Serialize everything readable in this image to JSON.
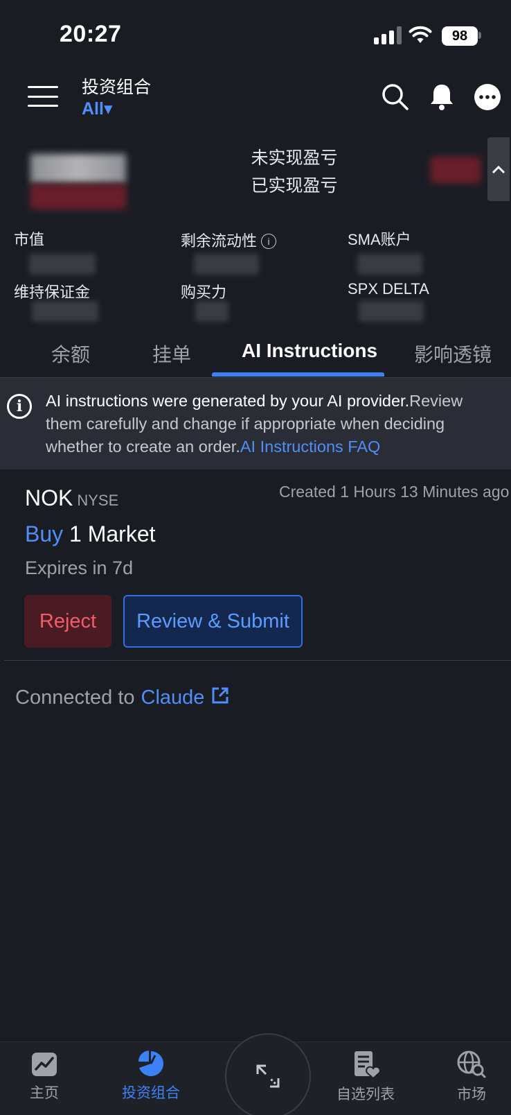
{
  "status_bar": {
    "time": "20:27",
    "battery": "98"
  },
  "header": {
    "title": "投资组合",
    "filter": "All▾"
  },
  "summary": {
    "unrealized_pnl_label": "未实现盈亏",
    "realized_pnl_label": "已实现盈亏",
    "metrics": [
      {
        "label": "市值"
      },
      {
        "label": "剩余流动性"
      },
      {
        "label": "SMA账户"
      },
      {
        "label": "维持保证金"
      },
      {
        "label": "购买力"
      },
      {
        "label": "SPX DELTA"
      }
    ],
    "info_glyph": "i"
  },
  "tabs": [
    "余额",
    "挂单",
    "AI Instructions",
    "影响透镜"
  ],
  "active_tab": "AI Instructions",
  "banner": {
    "text_primary": "AI instructions were generated by your AI provider.",
    "text_secondary": "Review them carefully and change if appropriate when deciding whether to create an order.",
    "link": "AI Instructions FAQ"
  },
  "instruction": {
    "ticker": "NOK",
    "exchange": "NYSE",
    "created": "Created 1 Hours 13 Minutes ago",
    "side": "Buy",
    "detail": "1 Market",
    "expires": "Expires in 7d",
    "reject_label": "Reject",
    "review_label": "Review & Submit"
  },
  "connection": {
    "prefix": "Connected to",
    "provider": "Claude"
  },
  "bottom_nav": [
    {
      "label": "主页",
      "icon": "chart-icon"
    },
    {
      "label": "投资组合",
      "icon": "pie-chart-icon",
      "active": true
    },
    {
      "label": "",
      "icon": "expand-arrows-icon"
    },
    {
      "label": "自选列表",
      "icon": "watchlist-icon"
    },
    {
      "label": "市场",
      "icon": "globe-search-icon"
    }
  ],
  "colors": {
    "background": "#1a1c24",
    "accent": "#3b82f6",
    "link": "#4f8ff7",
    "reject": "#f25c6b",
    "banner_bg": "#2a2d36"
  }
}
